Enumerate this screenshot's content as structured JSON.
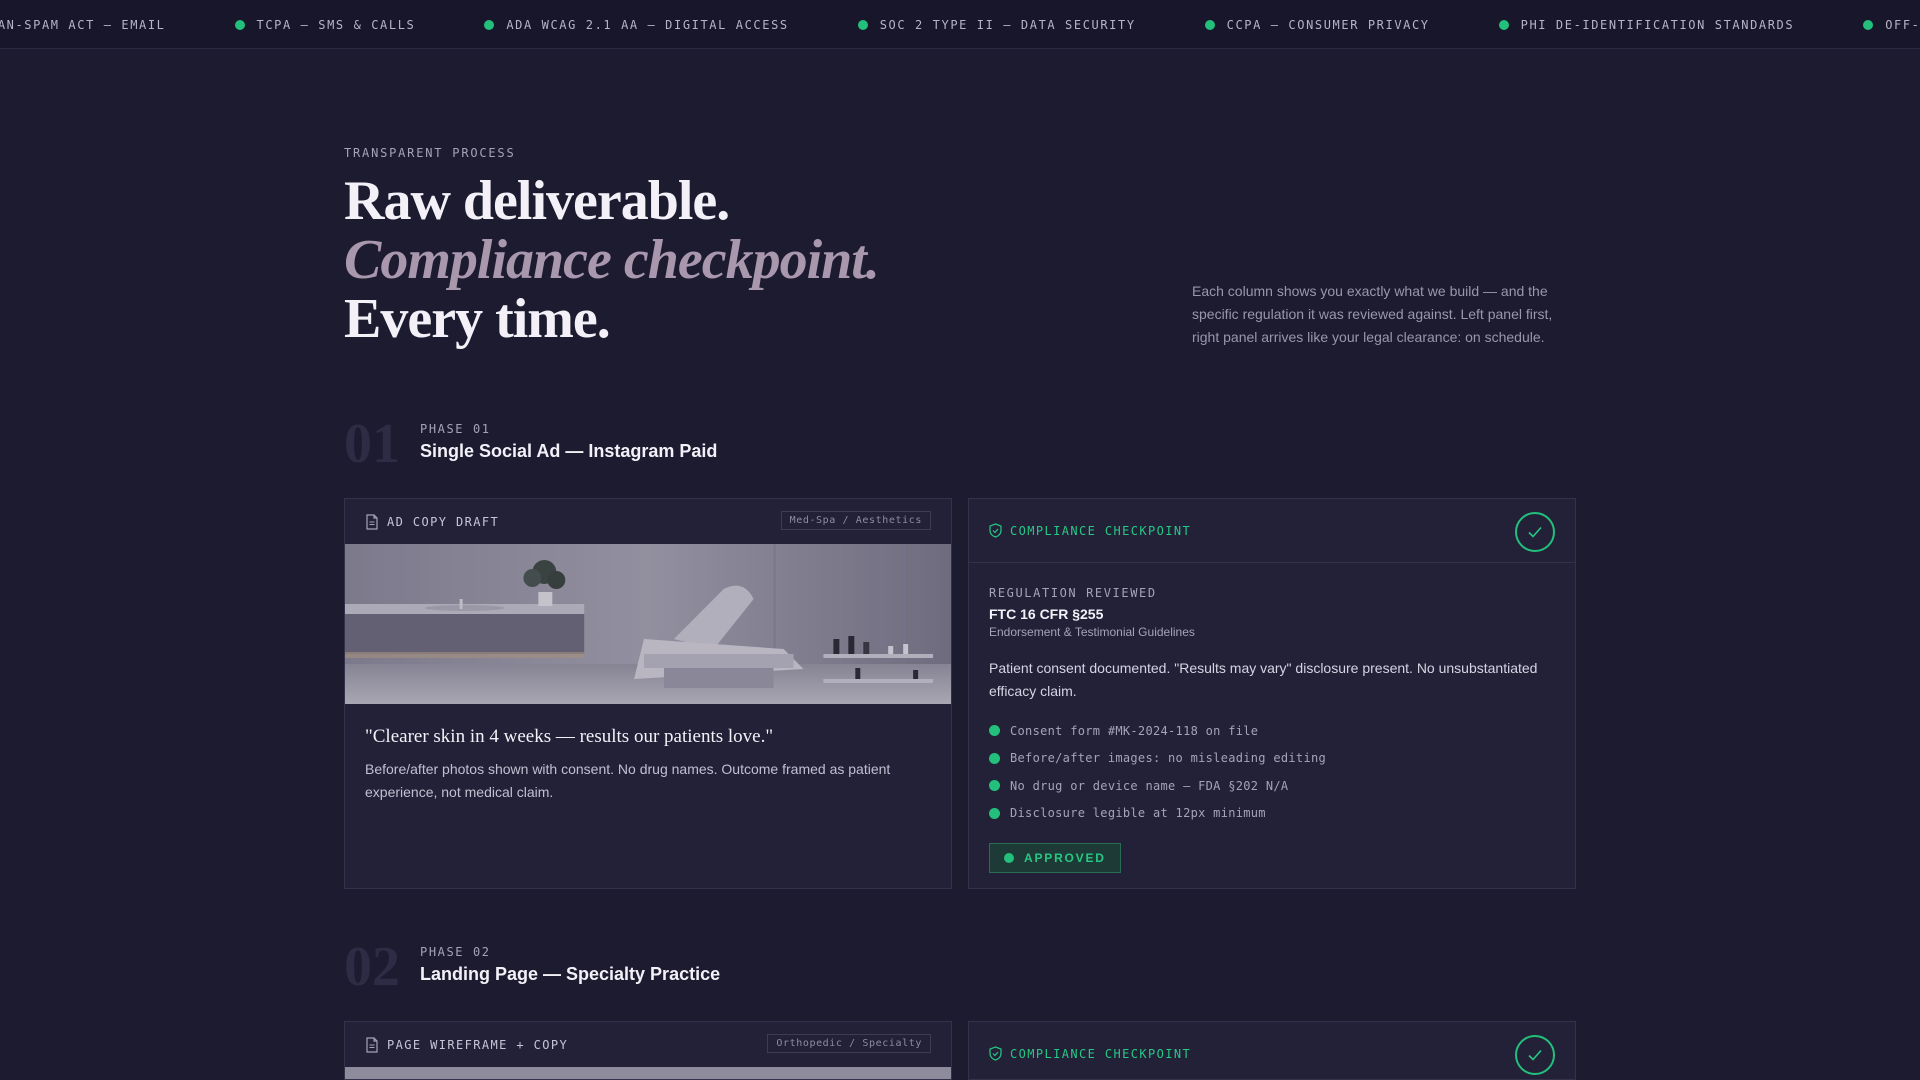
{
  "ticker": {
    "items": [
      "CAN-SPAM ACT — EMAIL",
      "TCPA — SMS & CALLS",
      "ADA WCAG 2.1 AA — DIGITAL ACCESS",
      "SOC 2 TYPE II — DATA SECURITY",
      "CCPA — CONSUMER PRIVACY",
      "PHI DE-IDENTIFICATION STANDARDS",
      "OFF-LABEL PROMOTION"
    ],
    "accent": "#22c07a"
  },
  "hero": {
    "eyebrow": "TRANSPARENT PROCESS",
    "line1": "Raw deliverable.",
    "line2": "Compliance checkpoint.",
    "line3": "Every time.",
    "intro": "Each column shows you exactly what we build — and the specific regulation it was reviewed against. Left panel first, right panel arrives like your legal clearance: on schedule."
  },
  "phases": [
    {
      "num": "01",
      "eyebrow": "PHASE 01",
      "title": "Single Social Ad — Instagram Paid",
      "draft": {
        "icon": "document-icon",
        "label": "AD COPY DRAFT",
        "tag": "Med-Spa / Aesthetics",
        "quote": "\"Clearer skin in 4 weeks — results our patients love.\"",
        "desc": "Before/after photos shown with consent. No drug names. Outcome framed as patient experience, not medical claim."
      },
      "compliance": {
        "icon": "shield-icon",
        "label": "COMPLIANCE CHECKPOINT",
        "reg_eyebrow": "REGULATION REVIEWED",
        "reg_title": "FTC 16 CFR §255",
        "reg_sub": "Endorsement & Testimonial Guidelines",
        "note": "Patient consent documented. \"Results may vary\" disclosure present. No unsubstantiated efficacy claim.",
        "checks": [
          "Consent form #MK-2024-118 on file",
          "Before/after images: no misleading editing",
          "No drug or device name — FDA §202 N/A",
          "Disclosure legible at 12px minimum"
        ],
        "status": "APPROVED"
      }
    },
    {
      "num": "02",
      "eyebrow": "PHASE 02",
      "title": "Landing Page — Specialty Practice",
      "draft": {
        "icon": "document-icon",
        "label": "PAGE WIREFRAME + COPY",
        "tag": "Orthopedic / Specialty"
      },
      "compliance": {
        "icon": "shield-icon",
        "label": "COMPLIANCE CHECKPOINT"
      }
    }
  ]
}
